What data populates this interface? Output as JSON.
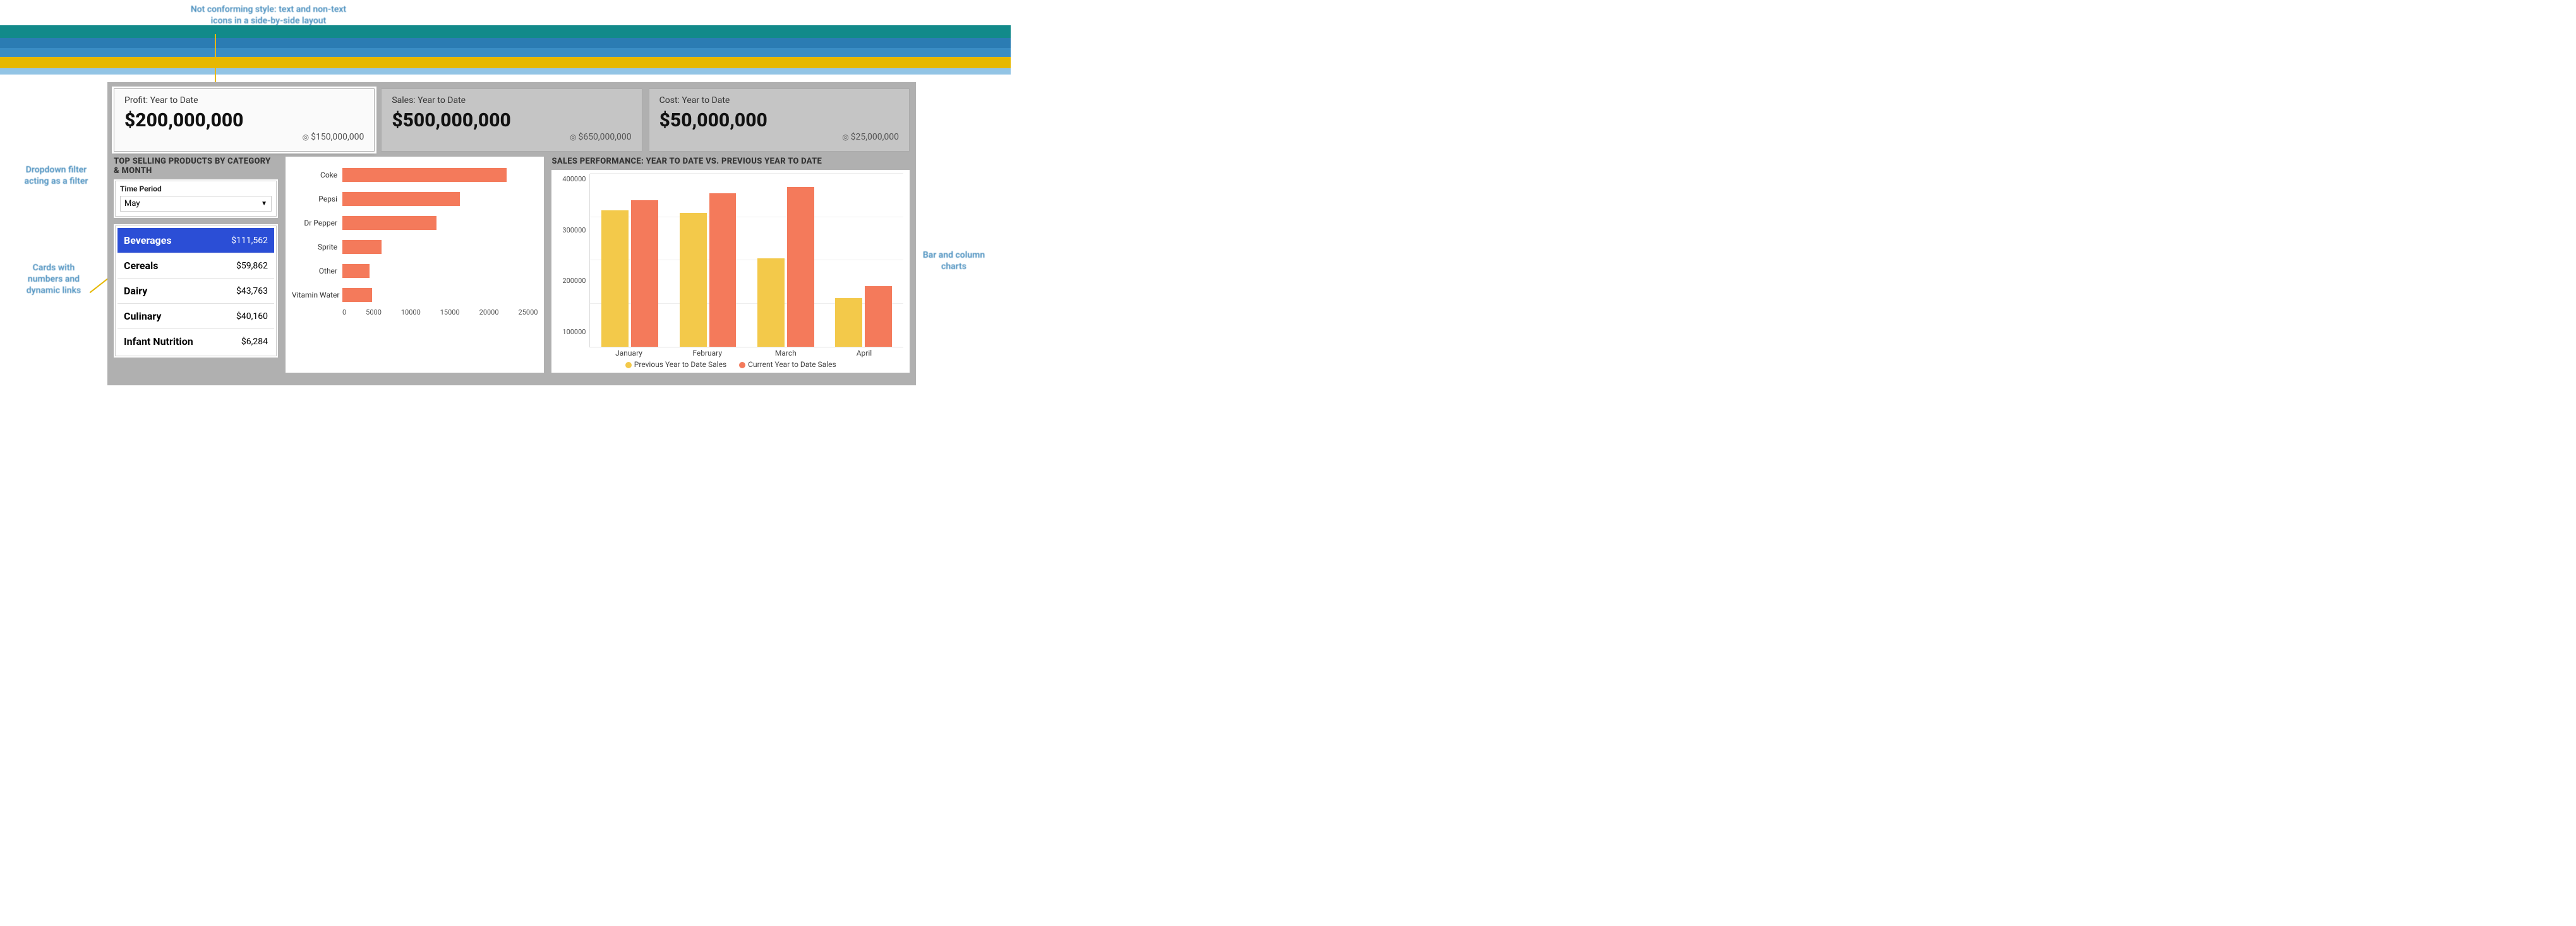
{
  "annotations": {
    "topcenter": "Not conforming style: text and non-text icons in a side-by-side layout",
    "leftdrop": "Dropdown filter acting as a filter",
    "leftcards": "Cards with numbers and dynamic links",
    "right": "Bar and column charts"
  },
  "kpis": [
    {
      "label": "Profit: Year to Date",
      "value": "$200,000,000",
      "target": "$150,000,000",
      "highlight": true
    },
    {
      "label": "Sales: Year to Date",
      "value": "$500,000,000",
      "target": "$650,000,000",
      "highlight": false
    },
    {
      "label": "Cost: Year to Date",
      "value": "$50,000,000",
      "target": "$25,000,000",
      "highlight": false
    }
  ],
  "left_section_title": "TOP SELLING PRODUCTS BY CATEGORY & MONTH",
  "right_section_title": "SALES PERFORMANCE: YEAR TO DATE VS. PREVIOUS YEAR TO DATE",
  "filter": {
    "label": "Time Period",
    "value": "May"
  },
  "categories": [
    {
      "name": "Beverages",
      "value": "$111,562",
      "active": true
    },
    {
      "name": "Cereals",
      "value": "$59,862",
      "active": false
    },
    {
      "name": "Dairy",
      "value": "$43,763",
      "active": false
    },
    {
      "name": "Culinary",
      "value": "$40,160",
      "active": false
    },
    {
      "name": "Infant Nutrition",
      "value": "$6,284",
      "active": false
    }
  ],
  "chart_data": [
    {
      "type": "bar",
      "orientation": "horizontal",
      "title": "Top Selling Products — Beverages, May",
      "categories": [
        "Coke",
        "Pepsi",
        "Dr Pepper",
        "Sprite",
        "Other",
        "Vitamin Water"
      ],
      "values": [
        21000,
        15000,
        12000,
        5000,
        3500,
        3800
      ],
      "xlabel": "",
      "ylabel": "",
      "xlim": [
        0,
        25000
      ],
      "x_ticks": [
        0,
        5000,
        10000,
        15000,
        20000,
        25000
      ]
    },
    {
      "type": "bar",
      "grouped": true,
      "title": "Sales Performance: Year to Date vs. Previous Year to Date",
      "categories": [
        "January",
        "February",
        "March",
        "April"
      ],
      "series": [
        {
          "name": "Previous Year to Date Sales",
          "values": [
            315000,
            310000,
            205000,
            112000
          ]
        },
        {
          "name": "Current Year to Date Sales",
          "values": [
            338000,
            355000,
            370000,
            140000
          ]
        }
      ],
      "ylabel": "",
      "xlabel": "",
      "ylim": [
        0,
        400000
      ],
      "y_ticks": [
        100000,
        200000,
        300000,
        400000
      ],
      "legend_labels": [
        "Previous Year to Date Sales",
        "Current Year to Date Sales"
      ]
    }
  ]
}
